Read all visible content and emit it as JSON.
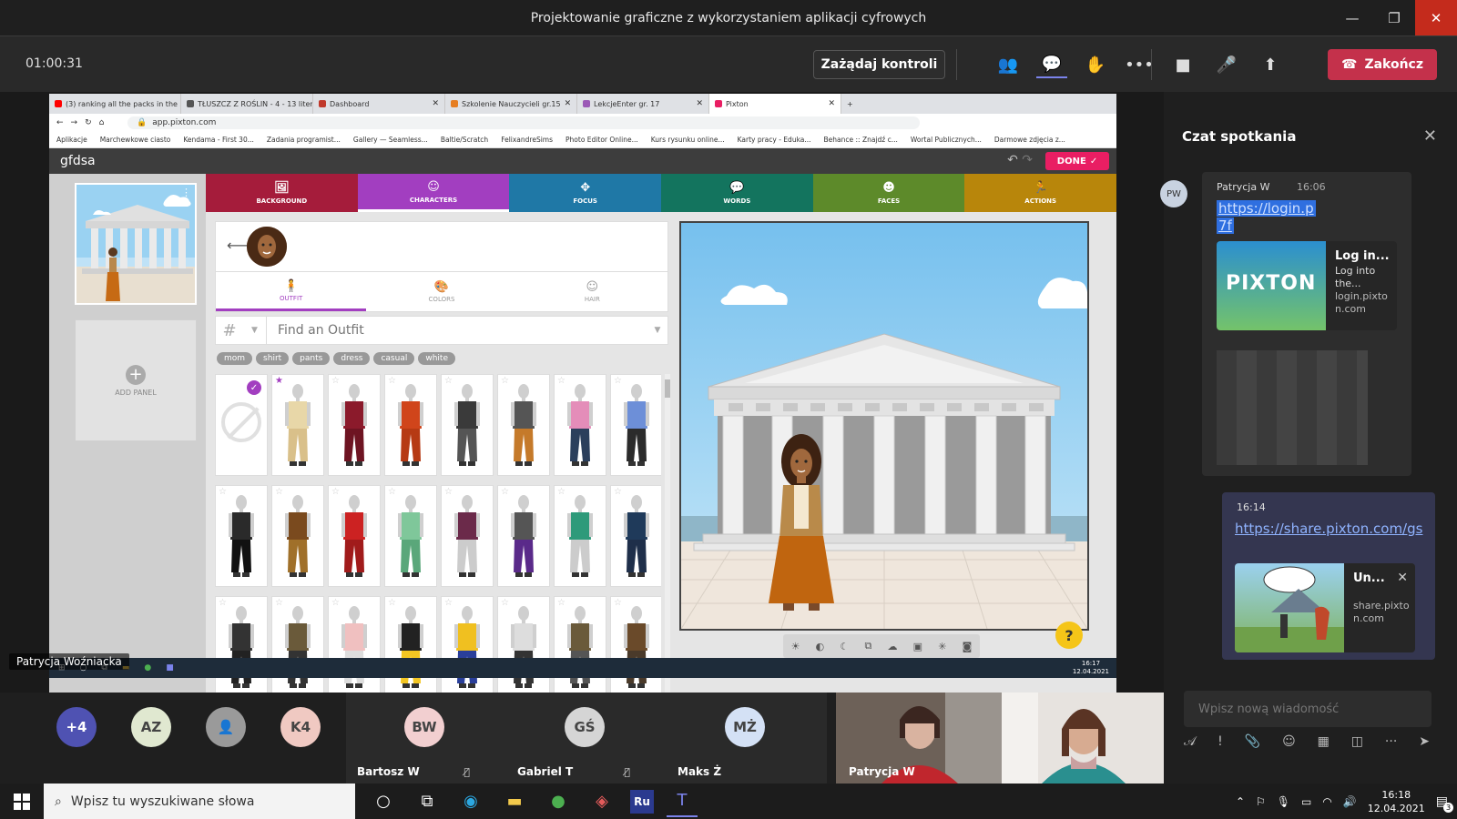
{
  "window": {
    "title": "Projektowanie graficzne z wykorzystaniem aplikacji cyfrowych"
  },
  "meeting": {
    "timer": "01:00:31",
    "request_control": "Zażądaj kontroli",
    "end_label": "Zakończ"
  },
  "browser": {
    "tabs": [
      {
        "label": "(3) ranking all the packs in the si",
        "color": "#ff0000"
      },
      {
        "label": "TŁUSZCZ Z ROŚLIN - 4 - 13 liter",
        "color": "#555555"
      },
      {
        "label": "Dashboard",
        "color": "#c0392b"
      },
      {
        "label": "Szkolenie Nauczycieli gr.15",
        "color": "#e67e22"
      },
      {
        "label": "LekcjeEnter gr. 17",
        "color": "#9b59b6"
      },
      {
        "label": "Pixton",
        "color": "#e91e63"
      }
    ],
    "url": "app.pixton.com",
    "bookmarks": [
      "Aplikacje",
      "Marchewkowe ciasto",
      "Kendama - First 30...",
      "Zadania programist...",
      "Gallery — Seamless...",
      "Baltie/Scratch",
      "FelixandreSims",
      "Photo Editor Online...",
      "Kurs rysunku online...",
      "Karty pracy - Eduka...",
      "Behance :: Znajdź c...",
      "Wortal Publicznych...",
      "Darmowe zdjęcia z..."
    ]
  },
  "pixton": {
    "title": "gfdsa",
    "done": "DONE",
    "add_panel": "ADD PANEL",
    "tabs": [
      {
        "label": "BACKGROUND",
        "color": "#a51c3b"
      },
      {
        "label": "CHARACTERS",
        "color": "#a23ec0"
      },
      {
        "label": "FOCUS",
        "color": "#1f78a6"
      },
      {
        "label": "WORDS",
        "color": "#13745e"
      },
      {
        "label": "FACES",
        "color": "#5d8a2a"
      },
      {
        "label": "ACTIONS",
        "color": "#b8860b"
      }
    ],
    "subtabs": [
      "OUTFIT",
      "COLORS",
      "HAIR"
    ],
    "search_placeholder": "Find an Outfit",
    "hash": "#",
    "tags": [
      "mom",
      "shirt",
      "pants",
      "dress",
      "casual",
      "white"
    ],
    "help": "?"
  },
  "remote": {
    "time": "16:17",
    "date": "12.04.2021"
  },
  "presenter": "Patrycja Woźniacka",
  "chat": {
    "title": "Czat spotkania",
    "msg1": {
      "author": "Patrycja W",
      "initials": "PW",
      "time": "16:06",
      "link1": "https://login.p",
      "link2": "7f",
      "preview_title": "Log in...",
      "preview_desc": "Log into the...",
      "preview_domain": "login.pixton.com",
      "preview_brand": "PIXTON"
    },
    "msg2": {
      "time": "16:14",
      "link": "https://share.pixton.com/gs",
      "preview_title": "Un...",
      "preview_domain": "share.pixton.com"
    },
    "input_placeholder": "Wpisz nową wiadomość"
  },
  "participants": [
    {
      "initials": "+4",
      "bg": "#4f52b2",
      "fg": "#ffffff"
    },
    {
      "initials": "AZ",
      "bg": "#e0e8d0",
      "fg": "#444444"
    },
    {
      "initials": "",
      "bg": "#9a9a9a",
      "fg": "#ffffff"
    },
    {
      "initials": "K4",
      "bg": "#f0c9c2",
      "fg": "#444444"
    }
  ],
  "tiles": [
    {
      "initials": "BW",
      "name": "Bartosz W",
      "bg": "#f2cfd0"
    },
    {
      "initials": "GŚ",
      "name": "Gabriel T",
      "bg": "#d5d5d5"
    },
    {
      "initials": "MŻ",
      "name": "Maks Ż",
      "bg": "#d4e1f5"
    }
  ],
  "video_name": "Patrycja W",
  "taskbar": {
    "search": "Wpisz tu wyszukiwane słowa",
    "time": "16:18",
    "date": "12.04.2021",
    "notif": "3"
  }
}
